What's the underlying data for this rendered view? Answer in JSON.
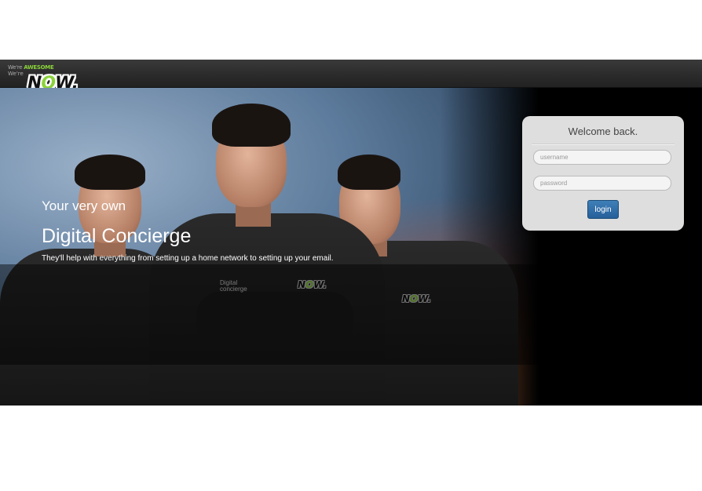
{
  "brand": {
    "tagline_top_prefix": "We're ",
    "tagline_top_highlight": "AWESOME",
    "tagline_bottom": "We're",
    "logo_n": "N",
    "logo_o": "O",
    "logo_w": "W."
  },
  "hero": {
    "subtitle": "Your very own",
    "title": "Digital Concierge",
    "description": "They'll help with everything from setting up a home network to setting up your email.",
    "shirt_badge_n": "N",
    "shirt_badge_o": "O",
    "shirt_badge_w": "W.",
    "shirt_label_1": "Digital",
    "shirt_label_2": "concierge"
  },
  "login": {
    "heading": "Welcome back.",
    "username_placeholder": "username",
    "password_placeholder": "password",
    "button_label": "login"
  },
  "colors": {
    "brand_green": "#8ad33a",
    "button_blue": "#2f6ea8",
    "topbar": "#2c2c2c"
  }
}
